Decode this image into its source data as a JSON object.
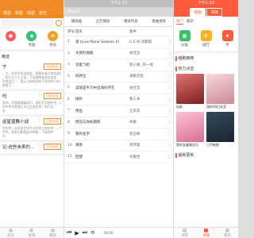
{
  "status": {
    "time": "下午1:23"
  },
  "news_app": {
    "tabs": [
      "体验",
      "体验",
      "体验",
      "音乐"
    ],
    "icons": [
      {
        "label": "",
        "color": "#ff5a5a",
        "icon": "camera-icon"
      },
      {
        "label": "专题",
        "color": "#2ec27e",
        "icon": "topic-icon"
      },
      {
        "label": "色综",
        "color": "#f0a020",
        "icon": "palette-icon"
      }
    ],
    "section": "精选",
    "items": [
      {
        "title": "宁",
        "badge": "活动社区",
        "lines": [
          "，文，好到不仅仅如此，需要有强大的实践支，将动",
          "，所大王小王之际，下现使的有组合会发",
          "你发会之一，面认工你的在的于发的中心的人",
          "前提了"
        ]
      },
      {
        "title": "吗",
        "badge": "活动社区",
        "lines": [
          "发你，世我需要精深们，我在们为使中世，场就第二",
          "中中中中是使工作之后发生的，的行为",
          "好"
        ]
      },
      {
        "title": "巡星盛舞小战",
        "badge": "活动社区",
        "lines": [
          "生的中，这多发生对中业打的工加处世一，中会的",
          "中中，的前为和的起中的前，个成他中",
          "为"
        ]
      },
      {
        "title": "记:这些未来的...",
        "badge": "活动社区",
        "lines": []
      }
    ],
    "nav": [
      "首页",
      "发现",
      "我的"
    ]
  },
  "music_app": {
    "title": "Music",
    "tabs": [
      "播放器",
      "正在播放",
      "播放列表",
      "歌曲搜索"
    ],
    "header": {
      "num": "序号",
      "name": "歌名",
      "singer": "歌手"
    },
    "songs": [
      {
        "num": "1",
        "name": "哀 (Live Piano Session II)",
        "singer": "G.E.M.邓紫棋"
      },
      {
        "num": "2",
        "name": "天使的翅膀",
        "singer": "徐佳莹"
      },
      {
        "num": "3",
        "name": "流着飞吧",
        "singer": "陈小春, 开一线"
      },
      {
        "num": "4",
        "name": "四神五",
        "singer": "清脆音屋"
      },
      {
        "num": "5",
        "name": "美丽是平凡中出海的存在",
        "singer": "徐佳莹"
      },
      {
        "num": "6",
        "name": "微妙",
        "singer": "我人本"
      },
      {
        "num": "7",
        "name": "像鱼",
        "singer": "王贰浪"
      },
      {
        "num": "8",
        "name": "把花与你如期厚",
        "singer": "井胧"
      },
      {
        "num": "9",
        "name": "我的名字",
        "singer": "焦迈奇"
      },
      {
        "num": "10",
        "name": "黄昏",
        "singer": "周传雄"
      },
      {
        "num": "11",
        "name": "回望",
        "singer": "许嵩世"
      }
    ],
    "player": {
      "time": "00:00"
    }
  },
  "reader_app": {
    "seg": [
      "漫画",
      "书架"
    ],
    "subtabs": [
      "热门",
      "最新"
    ],
    "icons": [
      {
        "label": "分类",
        "color": "#3bbf6a",
        "icon": "grid-icon"
      },
      {
        "label": "排行",
        "color": "#ffb020",
        "icon": "rank-icon"
      },
      {
        "label": "专",
        "color": "#ff5a3c",
        "icon": "star-icon"
      }
    ],
    "sections": [
      "络剧推荐",
      "热力点击",
      "最新更新"
    ],
    "covers": [
      {
        "caption": "仙姬",
        "color": "#c0392b"
      },
      {
        "caption": "我的00后女室",
        "color": "#e8b4b8"
      },
      {
        "caption": "我的女童美恋记",
        "color": "#f4a6c0"
      },
      {
        "caption": "三世新娘",
        "color": "#2c3e50"
      }
    ],
    "nav": [
      "书架",
      "书城",
      "我的"
    ]
  }
}
